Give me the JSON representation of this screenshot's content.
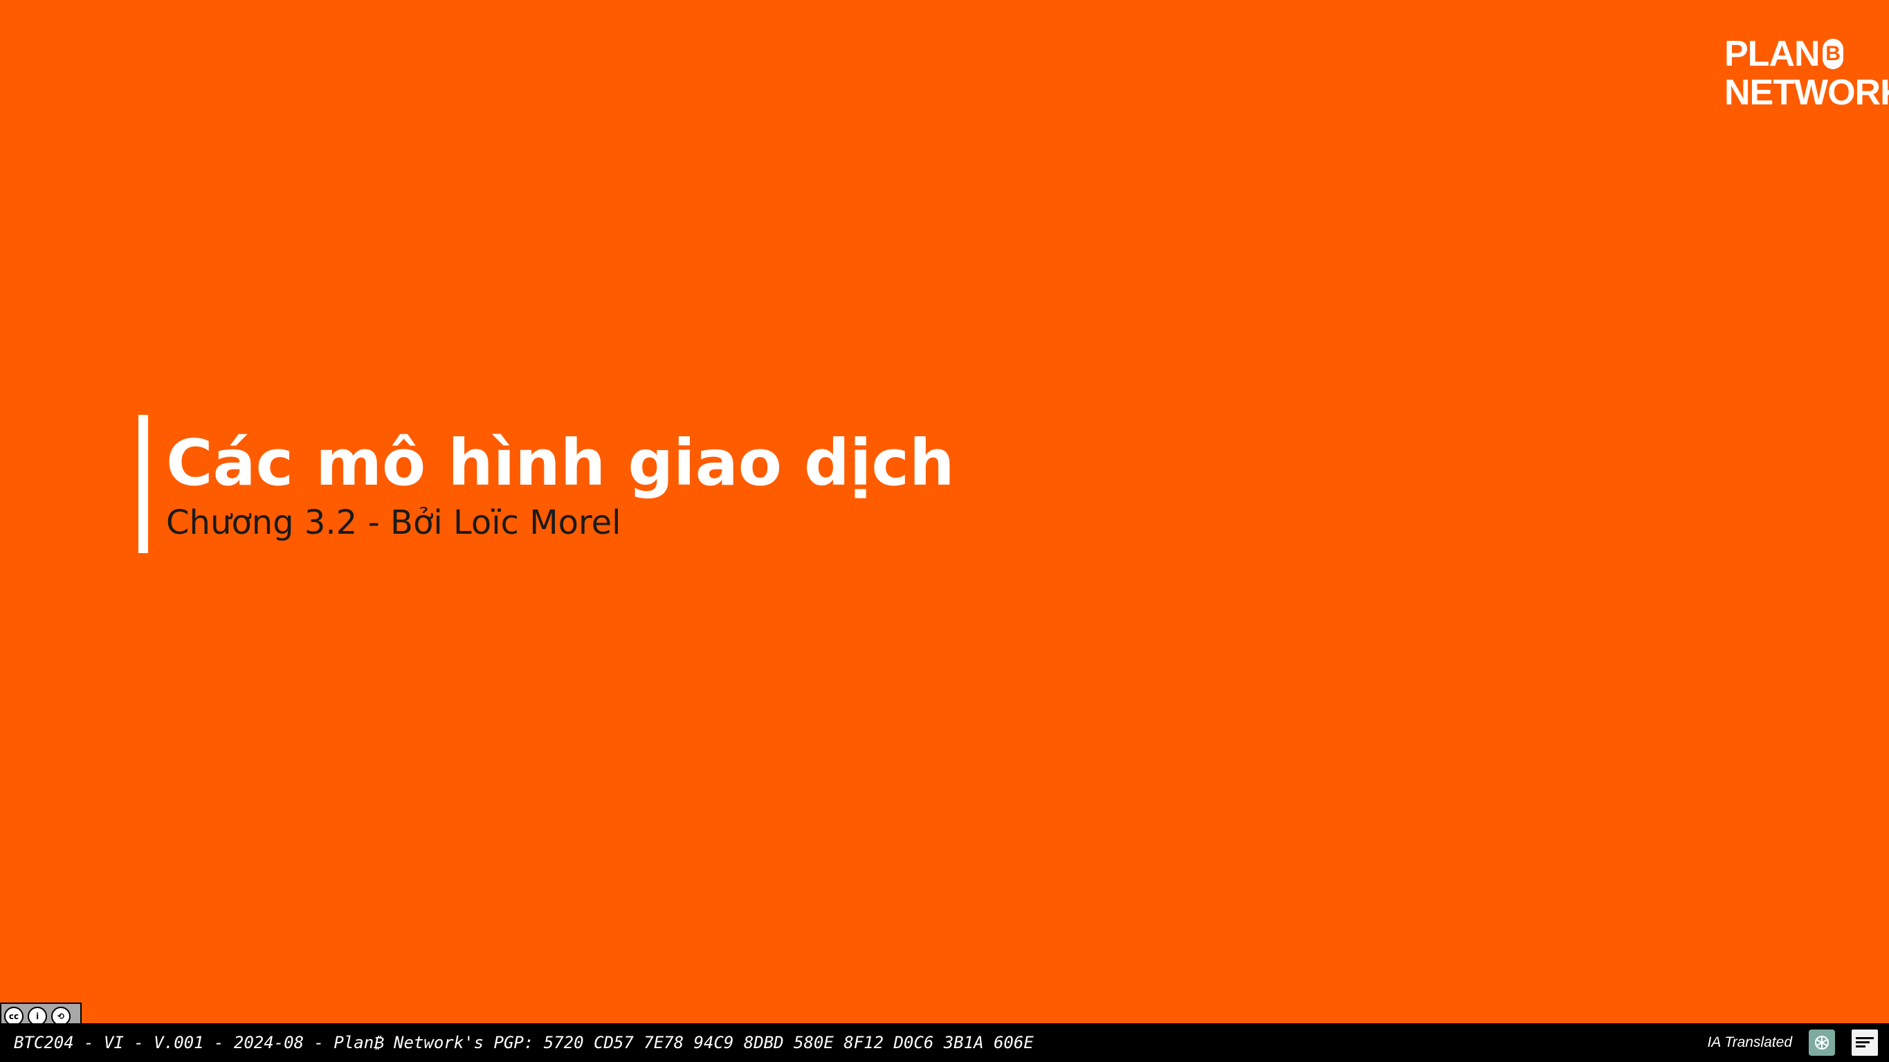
{
  "slide": {
    "background_color": "#FF5C00",
    "title": "Các mô hình giao dịch",
    "subtitle": "Chương 3.2 - Bởi Loïc Morel"
  },
  "logo": {
    "line1": "PLAN",
    "mark": "B",
    "line2": "NETWORK"
  },
  "license": {
    "icon": "cc-by-sa-icon"
  },
  "footer": {
    "text": "BTC204 - VI - V.001 - 2024-08 - Plan₿ Network's PGP: 5720 CD57 7E78 94C9 8DBD 580E 8F12 D0C6 3B1A 606E",
    "ia_label": "IA Translated",
    "icons": [
      "openai-icon",
      "translation-lab-icon"
    ]
  }
}
